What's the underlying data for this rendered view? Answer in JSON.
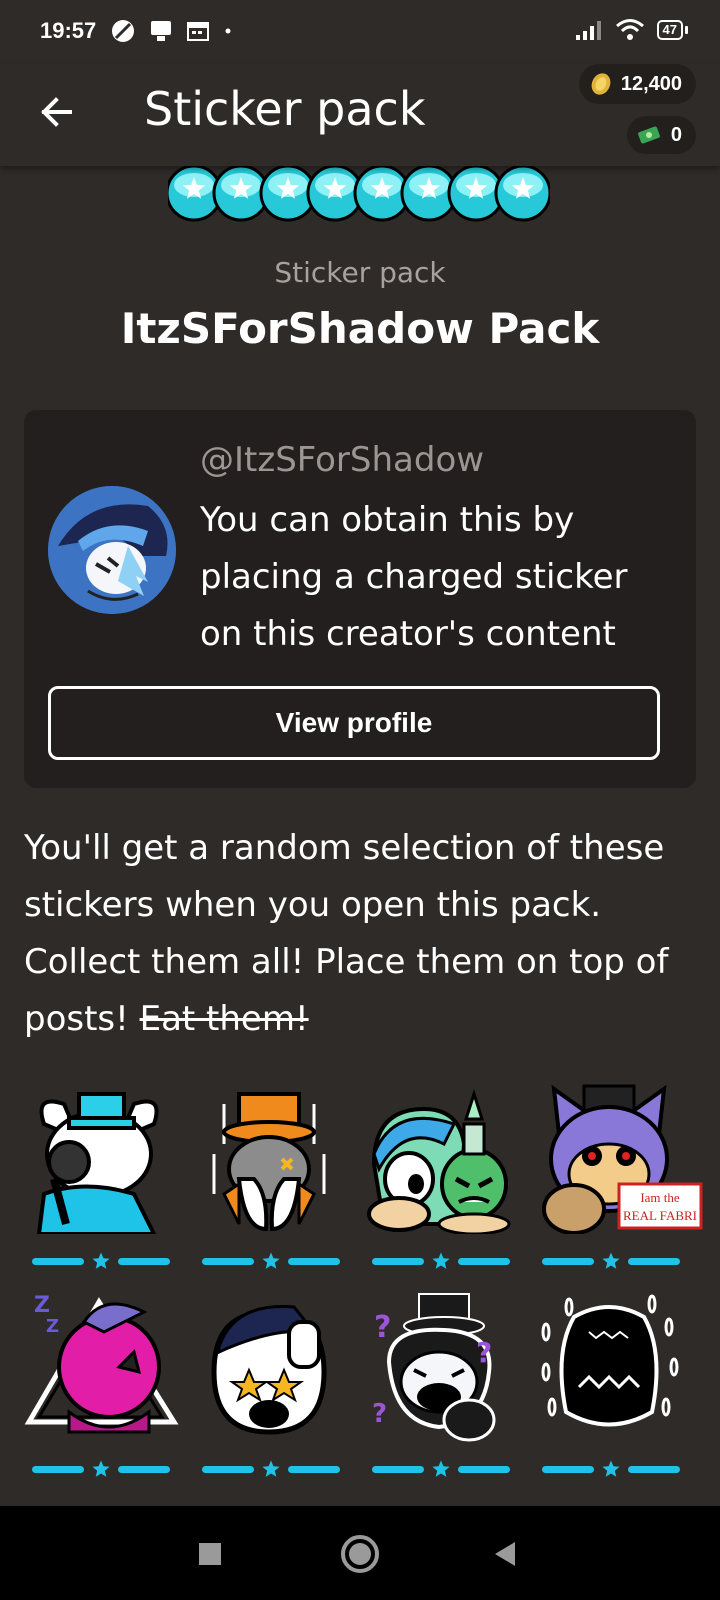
{
  "status_bar": {
    "time": "19:57",
    "battery": "47",
    "left_icons": [
      "soccer-icon",
      "cast-icon",
      "calendar-icon",
      "dot-icon"
    ],
    "right_icons": [
      "signal-icon",
      "wifi-icon",
      "battery-icon"
    ]
  },
  "app_bar": {
    "title": "Sticker pack",
    "coins": "12,400",
    "cash": "0",
    "back_icon": "arrow-left-icon"
  },
  "pack": {
    "label": "Sticker pack",
    "name": "ItzSForShadow Pack",
    "description_main": "You'll get a random selection of these stickers when you open this pack. Collect them all! Place them on top of posts! ",
    "description_struck": "Eat them!"
  },
  "creator": {
    "handle": "@ItzSForShadow",
    "info": "You can obtain this by placing a charged sticker on this creator's content",
    "view_profile_label": "View profile"
  },
  "stickers": [
    {
      "id": "sticker-1",
      "rarity": 1
    },
    {
      "id": "sticker-2",
      "rarity": 1
    },
    {
      "id": "sticker-3",
      "rarity": 1
    },
    {
      "id": "sticker-4",
      "rarity": 1,
      "sign_text": "Iam the REAL FABRI"
    },
    {
      "id": "sticker-5",
      "rarity": 1
    },
    {
      "id": "sticker-6",
      "rarity": 1
    },
    {
      "id": "sticker-7",
      "rarity": 1
    },
    {
      "id": "sticker-8",
      "rarity": 1
    }
  ],
  "colors": {
    "background": "#2e2b29",
    "card": "#221f1e",
    "accent_cyan": "#1fc3e8",
    "muted_text": "#a7a29d"
  },
  "nav_bar": {
    "buttons": [
      "recents-square-icon",
      "home-circle-icon",
      "back-triangle-icon"
    ]
  }
}
